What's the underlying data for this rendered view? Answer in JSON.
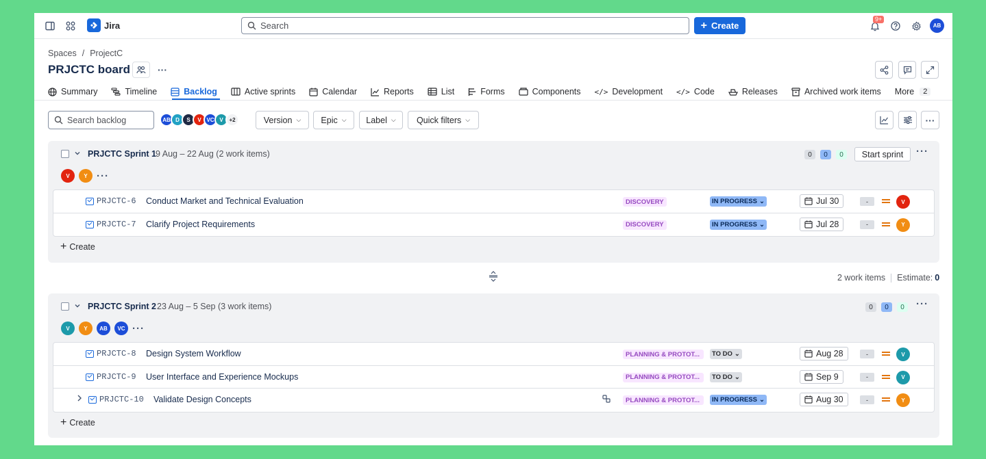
{
  "topbar": {
    "app_name": "Jira",
    "search_placeholder": "Search",
    "create_label": "Create",
    "notification_badge": "9+",
    "user_initials": "AB"
  },
  "header": {
    "breadcrumb": [
      "Spaces",
      "/",
      "ProjectC"
    ],
    "title": "PRJCTC board"
  },
  "tabs": [
    {
      "label": "Summary"
    },
    {
      "label": "Timeline"
    },
    {
      "label": "Backlog"
    },
    {
      "label": "Active sprints"
    },
    {
      "label": "Calendar"
    },
    {
      "label": "Reports"
    },
    {
      "label": "List"
    },
    {
      "label": "Forms"
    },
    {
      "label": "Components"
    },
    {
      "label": "Development"
    },
    {
      "label": "Code"
    },
    {
      "label": "Releases"
    },
    {
      "label": "Archived work items"
    },
    {
      "label": "More",
      "count": "2"
    }
  ],
  "active_tab": "Backlog",
  "filters": {
    "search_placeholder": "Search backlog",
    "avatars": [
      "AB",
      "D",
      "S",
      "V",
      "VC",
      "V"
    ],
    "avatars_more": "+2",
    "version_label": "Version",
    "epic_label": "Epic",
    "label_label": "Label",
    "quick_filters_label": "Quick filters"
  },
  "sprints": [
    {
      "name": "PRJCTC Sprint 1",
      "dates": "9 Aug – 22 Aug (2 work items)",
      "counts": [
        "0",
        "0",
        "0"
      ],
      "action": "Start sprint",
      "assignees": [
        "V",
        "Y"
      ],
      "create_label": "Create",
      "items": [
        {
          "key": "PRJCTC-6",
          "summary": "Conduct Market and Technical Evaluation",
          "epic": "DISCOVERY",
          "status": "IN PROGRESS",
          "due": "Jul 30",
          "estimate": "-",
          "assignee": "V"
        },
        {
          "key": "PRJCTC-7",
          "summary": "Clarify Project Requirements",
          "epic": "DISCOVERY",
          "status": "IN PROGRESS",
          "due": "Jul 28",
          "estimate": "-",
          "assignee": "Y"
        }
      ]
    },
    {
      "name": "PRJCTC Sprint 2",
      "dates": "23 Aug – 5 Sep (3 work items)",
      "counts": [
        "0",
        "0",
        "0"
      ],
      "assignees": [
        "V",
        "Y",
        "AB",
        "VC"
      ],
      "create_label": "Create",
      "items": [
        {
          "key": "PRJCTC-8",
          "summary": "Design System Workflow",
          "epic": "PLANNING & PROTOT...",
          "status": "TO DO",
          "due": "Aug 28",
          "estimate": "-",
          "assignee": "V"
        },
        {
          "key": "PRJCTC-9",
          "summary": "User Interface and Experience Mockups",
          "epic": "PLANNING & PROTOT...",
          "status": "TO DO",
          "due": "Sep 9",
          "estimate": "-",
          "assignee": "V"
        },
        {
          "key": "PRJCTC-10",
          "summary": "Validate Design Concepts",
          "epic": "PLANNING & PROTOT...",
          "status": "IN PROGRESS",
          "due": "Aug 30",
          "estimate": "-",
          "assignee": "Y"
        }
      ]
    }
  ],
  "sprint1_footer": {
    "work_items": "2 work items",
    "estimate_label": "Estimate:",
    "estimate_value": "0"
  },
  "colors": {
    "accent": "#1868db",
    "avatar_v": "#e2240f",
    "avatar_y": "#f18d13",
    "avatar_v_teal": "#1d9aaa",
    "avatar_ab": "#1d4ed8",
    "avatar_d": "#22a2c4",
    "avatar_s": "#1f2a44",
    "avatar_vc": "#1d4ed8"
  }
}
